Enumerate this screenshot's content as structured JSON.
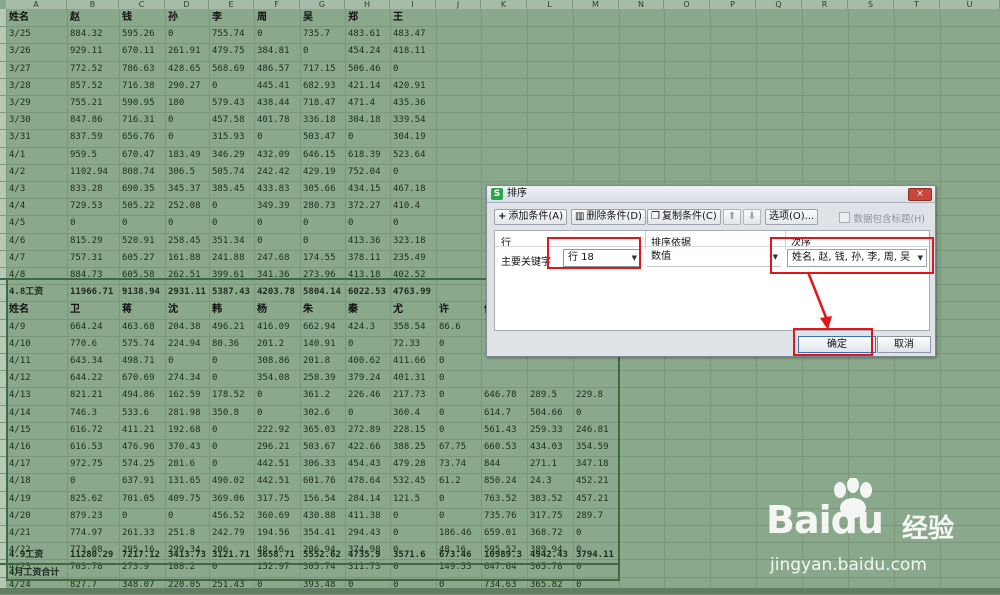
{
  "sheet": {
    "column_letters": [
      "A",
      "B",
      "C",
      "D",
      "E",
      "F",
      "G",
      "H",
      "I",
      "J",
      "K",
      "L",
      "M",
      "N",
      "O",
      "P",
      "Q",
      "R",
      "S",
      "T",
      "U"
    ],
    "table1": {
      "header": [
        "姓名",
        "赵",
        "钱",
        "孙",
        "李",
        "周",
        "吴",
        "郑",
        "王"
      ],
      "rows": [
        [
          "3/25",
          "884.32",
          "595.26",
          "0",
          "755.74",
          "0",
          "735.7",
          "483.61",
          "483.47"
        ],
        [
          "3/26",
          "929.11",
          "670.11",
          "261.91",
          "479.75",
          "384.81",
          "0",
          "454.24",
          "418.11"
        ],
        [
          "3/27",
          "772.52",
          "786.63",
          "428.65",
          "568.69",
          "486.57",
          "717.15",
          "506.46",
          "0"
        ],
        [
          "3/28",
          "857.52",
          "716.38",
          "290.27",
          "0",
          "445.41",
          "682.93",
          "421.14",
          "420.91"
        ],
        [
          "3/29",
          "755.21",
          "590.95",
          "180",
          "579.43",
          "438.44",
          "718.47",
          "471.4",
          "435.36"
        ],
        [
          "3/30",
          "847.86",
          "716.31",
          "0",
          "457.58",
          "401.78",
          "336.18",
          "304.18",
          "339.54"
        ],
        [
          "3/31",
          "837.59",
          "656.76",
          "0",
          "315.93",
          "0",
          "503.47",
          "0",
          "304.19"
        ],
        [
          "4/1",
          "959.5",
          "670.47",
          "183.49",
          "346.29",
          "432.09",
          "646.15",
          "618.39",
          "523.64"
        ],
        [
          "4/2",
          "1102.94",
          "808.74",
          "306.5",
          "505.74",
          "242.42",
          "429.19",
          "752.04",
          "0"
        ],
        [
          "4/3",
          "833.28",
          "690.35",
          "345.37",
          "385.45",
          "433.83",
          "305.66",
          "434.15",
          "467.18"
        ],
        [
          "4/4",
          "729.53",
          "505.22",
          "252.08",
          "0",
          "349.39",
          "280.73",
          "372.27",
          "410.4"
        ],
        [
          "4/5",
          "0",
          "0",
          "0",
          "0",
          "0",
          "0",
          "0",
          "0"
        ],
        [
          "4/6",
          "815.29",
          "520.91",
          "258.45",
          "351.34",
          "0",
          "0",
          "413.36",
          "323.18"
        ],
        [
          "4/7",
          "757.31",
          "605.27",
          "161.88",
          "241.88",
          "247.68",
          "174.55",
          "378.11",
          "235.49"
        ],
        [
          "4/8",
          "884.73",
          "605.58",
          "262.51",
          "399.61",
          "341.36",
          "273.96",
          "413.18",
          "402.52"
        ]
      ],
      "total": [
        "4.8工资",
        "11966.71",
        "9138.94",
        "2931.11",
        "5387.43",
        "4203.78",
        "5804.14",
        "6022.53",
        "4763.99"
      ]
    },
    "table2": {
      "header": [
        "姓名",
        "卫",
        "蒋",
        "沈",
        "韩",
        "杨",
        "朱",
        "秦",
        "尤",
        "许",
        "何",
        "吕",
        "施"
      ],
      "rows": [
        [
          "4/9",
          "664.24",
          "463.68",
          "204.38",
          "496.21",
          "416.09",
          "662.94",
          "424.3",
          "358.54",
          "86.6",
          "",
          "",
          ""
        ],
        [
          "4/10",
          "770.6",
          "575.74",
          "224.94",
          "80.36",
          "201.2",
          "140.91",
          "0",
          "72.33",
          "0",
          "",
          "",
          ""
        ],
        [
          "4/11",
          "643.34",
          "498.71",
          "0",
          "0",
          "308.86",
          "201.8",
          "400.62",
          "411.66",
          "0",
          "",
          "",
          ""
        ],
        [
          "4/12",
          "644.22",
          "670.69",
          "274.34",
          "0",
          "354.08",
          "258.39",
          "379.24",
          "401.31",
          "0",
          "",
          "",
          ""
        ],
        [
          "4/13",
          "821.21",
          "494.86",
          "162.59",
          "178.52",
          "0",
          "361.2",
          "226.46",
          "217.73",
          "0",
          "646.78",
          "289.5",
          "229.8"
        ],
        [
          "4/14",
          "746.3",
          "533.6",
          "281.98",
          "350.8",
          "0",
          "302.6",
          "0",
          "360.4",
          "0",
          "614.7",
          "504.66",
          "0"
        ],
        [
          "4/15",
          "616.72",
          "411.21",
          "192.68",
          "0",
          "222.92",
          "365.03",
          "272.89",
          "228.15",
          "0",
          "561.43",
          "259.33",
          "246.81"
        ],
        [
          "4/16",
          "616.53",
          "476.96",
          "370.43",
          "0",
          "296.21",
          "503.67",
          "422.66",
          "388.25",
          "67.75",
          "660.53",
          "434.03",
          "354.59"
        ],
        [
          "4/17",
          "972.75",
          "574.25",
          "281.6",
          "0",
          "442.51",
          "306.33",
          "454.43",
          "479.28",
          "73.74",
          "844",
          "271.1",
          "347.18"
        ],
        [
          "4/18",
          "0",
          "637.91",
          "131.65",
          "490.02",
          "442.51",
          "601.76",
          "478.64",
          "532.45",
          "61.2",
          "850.24",
          "24.3",
          "452.21"
        ],
        [
          "4/19",
          "825.62",
          "701.05",
          "409.75",
          "369.06",
          "317.75",
          "156.54",
          "284.14",
          "121.5",
          "0",
          "763.52",
          "383.52",
          "457.21"
        ],
        [
          "4/20",
          "879.23",
          "0",
          "0",
          "456.52",
          "360.69",
          "430.88",
          "411.38",
          "0",
          "0",
          "735.76",
          "317.75",
          "289.7"
        ],
        [
          "4/21",
          "774.97",
          "261.33",
          "251.8",
          "242.79",
          "194.56",
          "354.41",
          "294.43",
          "0",
          "186.46",
          "659.01",
          "368.72",
          "0"
        ],
        [
          "4/22",
          "773.08",
          "295.16",
          "299.34",
          "206",
          "48.16",
          "206.94",
          "374.98",
          "0",
          "48.16",
          "595.52",
          "389.94",
          "0"
        ],
        [
          "4/23",
          "703.78",
          "273.9",
          "108.2",
          "0",
          "152.97",
          "305.74",
          "311.73",
          "0",
          "149.55",
          "647.64",
          "305.78",
          "0"
        ],
        [
          "4/24",
          "827.7",
          "348.07",
          "220.05",
          "251.43",
          "0",
          "393.48",
          "0",
          "0",
          "0",
          "734.63",
          "365.82",
          "0"
        ]
      ],
      "total": [
        "4.9工资",
        "11280.29",
        "7217.12",
        "3413.73",
        "3121.71",
        "3658.71",
        "5552.62",
        "4735.9",
        "3571.6",
        "673.46",
        "10989.3",
        "4942.43",
        "3794.11"
      ],
      "footer": "4月工资合计"
    }
  },
  "dialog": {
    "title": "排序",
    "title_icon": "S",
    "close_label": "×",
    "toolbar": {
      "add": "添加条件(A)",
      "delete": "删除条件(D)",
      "copy": "复制条件(C)",
      "up": "⬆",
      "down": "⬇",
      "options": "选项(O)...",
      "has_header": "数据包含标题(H)"
    },
    "columns": {
      "col1": "行",
      "col2": "排序依据",
      "col3": "次序"
    },
    "row": {
      "label": "主要关键字",
      "key": "行 18",
      "basis": "数值",
      "order": "姓名, 赵, 钱, 孙, 李, 周, 吴"
    },
    "ok": "确定",
    "cancel": "取消"
  },
  "watermark": {
    "logo": "Baidu",
    "brand": "经验",
    "url": "jingyan.baidu.com"
  },
  "colors": {
    "highlight": "#e0161b",
    "sheet_overlay": "#8aa98c"
  }
}
